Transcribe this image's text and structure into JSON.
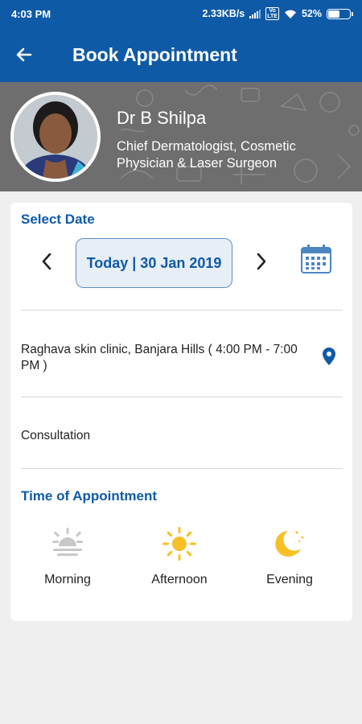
{
  "status_bar": {
    "time": "4:03 PM",
    "network_speed": "2.33KB/s",
    "volte": "Vo LTE",
    "battery": "52%",
    "battery_level": 0.52
  },
  "app_bar": {
    "title": "Book Appointment",
    "back_icon": "arrow-left-icon"
  },
  "doctor": {
    "name": "Dr B Shilpa",
    "title": "Chief Dermatologist, Cosmetic Physician & Laser Surgeon"
  },
  "booking": {
    "select_date_label": "Select Date",
    "selected_date": "Today | 30 Jan 2019",
    "prev_icon": "chevron-left-icon",
    "next_icon": "chevron-right-icon",
    "calendar_icon": "calendar-icon",
    "clinic": "Raghava skin clinic, Banjara Hills ( 4:00 PM - 7:00 PM )",
    "location_icon": "map-pin-icon",
    "consultation": "Consultation",
    "time_label": "Time of Appointment",
    "slots": [
      {
        "label": "Morning",
        "icon": "sunrise-icon",
        "state": "disabled"
      },
      {
        "label": "Afternoon",
        "icon": "sun-icon",
        "state": "available"
      },
      {
        "label": "Evening",
        "icon": "moon-icon",
        "state": "available"
      }
    ]
  },
  "colors": {
    "primary": "#0f5aa6",
    "accent_yellow": "#f6c026",
    "disabled_icon": "#c8c8c8",
    "banner_gray": "#6e6e6e"
  }
}
